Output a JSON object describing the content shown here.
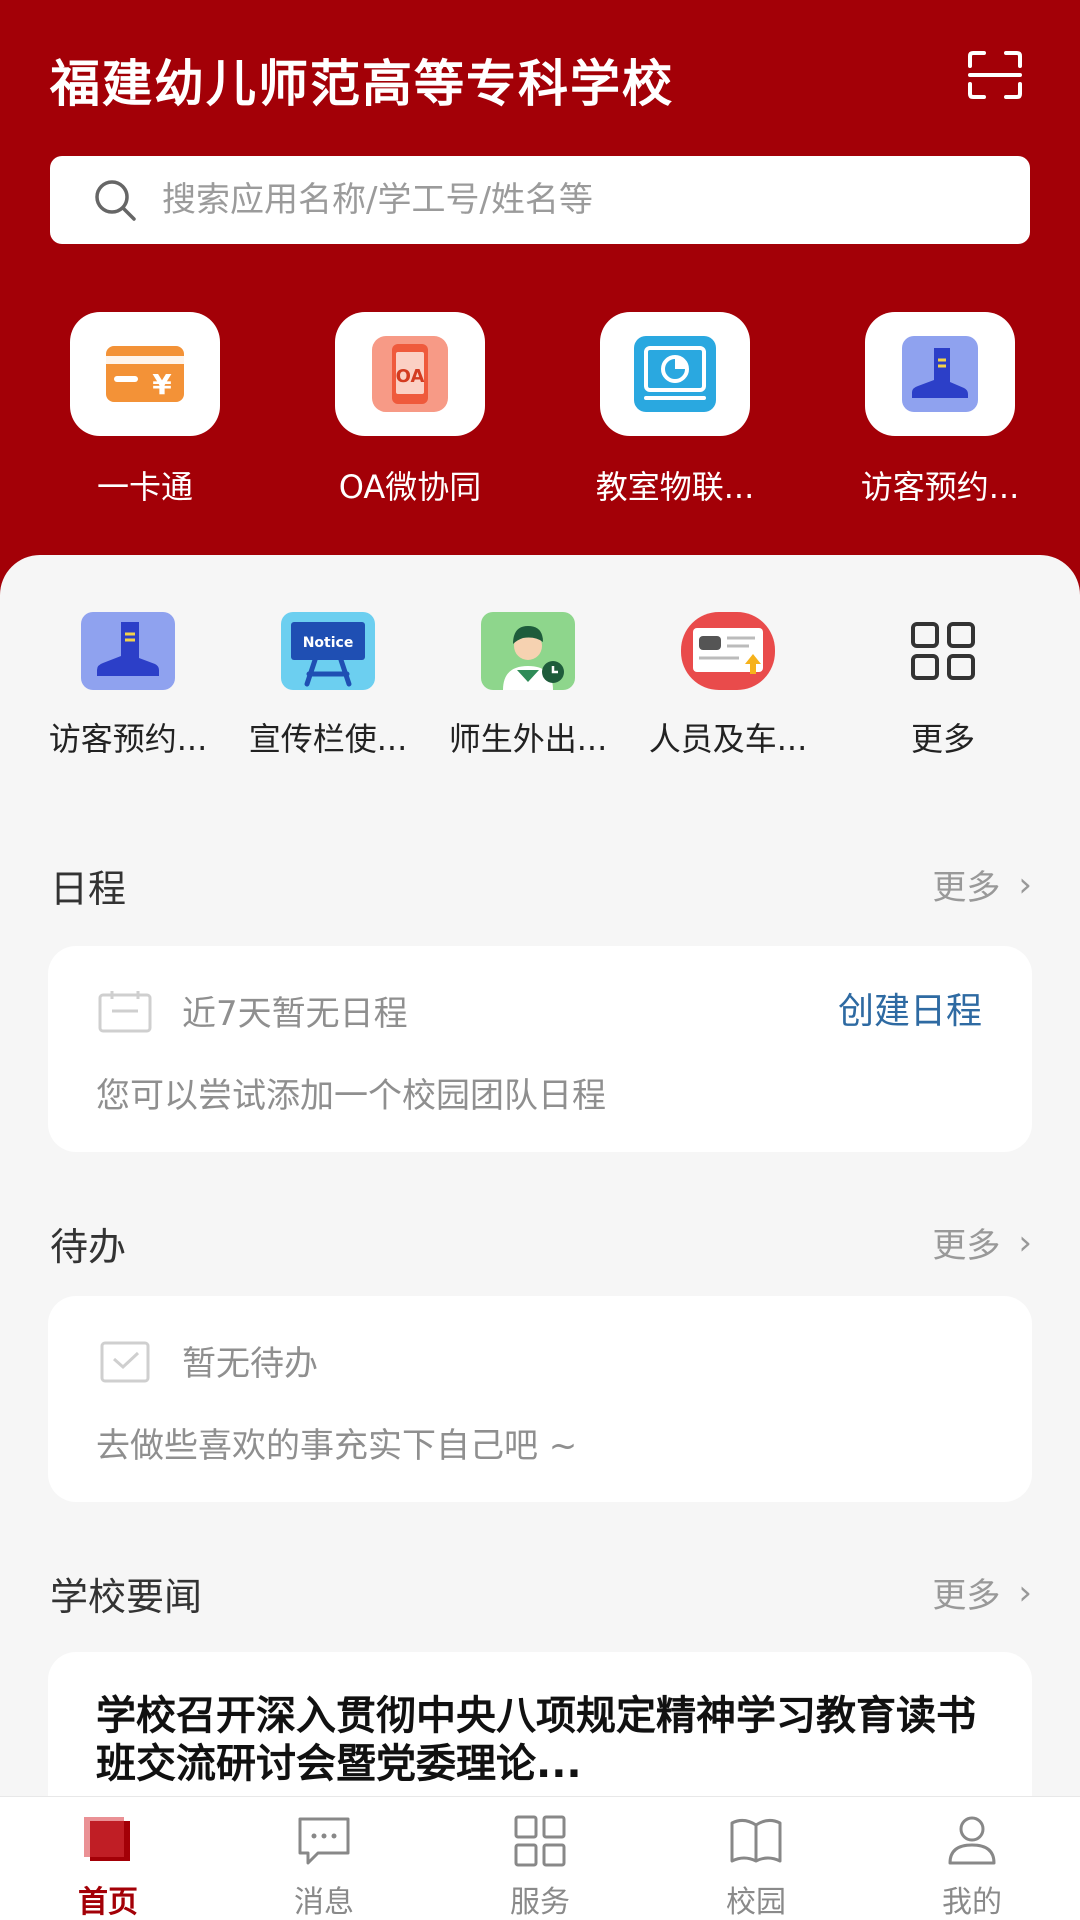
{
  "header": {
    "title": "福建幼儿师范高等专科学校",
    "scan_icon": "scan-icon"
  },
  "search": {
    "placeholder": "搜索应用名称/学工号/姓名等",
    "value": ""
  },
  "top_apps": [
    {
      "label": "一卡通",
      "icon": "card-icon"
    },
    {
      "label": "OA微协同",
      "icon": "oa-phone-icon"
    },
    {
      "label": "教室物联...",
      "icon": "monitor-chart-icon"
    },
    {
      "label": "访客预约...",
      "icon": "boot-icon"
    }
  ],
  "grid_apps": [
    {
      "label": "访客预约...",
      "icon": "boot-icon"
    },
    {
      "label": "宣传栏使...",
      "icon": "notice-board-icon",
      "icon_text": "Notice"
    },
    {
      "label": "师生外出...",
      "icon": "person-clock-icon"
    },
    {
      "label": "人员及车...",
      "icon": "car-card-icon"
    },
    {
      "label": "更多",
      "icon": "grid-icon"
    }
  ],
  "schedule": {
    "title": "日程",
    "more": "更多",
    "empty_text": "近7天暂无日程",
    "create_label": "创建日程",
    "hint": "您可以尝试添加一个校园团队日程"
  },
  "todo": {
    "title": "待办",
    "more": "更多",
    "empty_text": "暂无待办",
    "hint": "去做些喜欢的事充实下自己吧 ~"
  },
  "news": {
    "title": "学校要闻",
    "more": "更多",
    "items": [
      {
        "title": "学校召开深入贯彻中央八项规定精神学习教育读书班交流研讨会暨党委理论..."
      }
    ]
  },
  "bottom_nav": [
    {
      "label": "首页",
      "icon": "home-icon",
      "active": true
    },
    {
      "label": "消息",
      "icon": "message-icon",
      "active": false
    },
    {
      "label": "服务",
      "icon": "services-grid-icon",
      "active": false
    },
    {
      "label": "校园",
      "icon": "book-icon",
      "active": false
    },
    {
      "label": "我的",
      "icon": "user-icon",
      "active": false
    }
  ],
  "colors": {
    "brand": "#a30007",
    "link": "#2e6aa2",
    "muted": "#999999"
  }
}
